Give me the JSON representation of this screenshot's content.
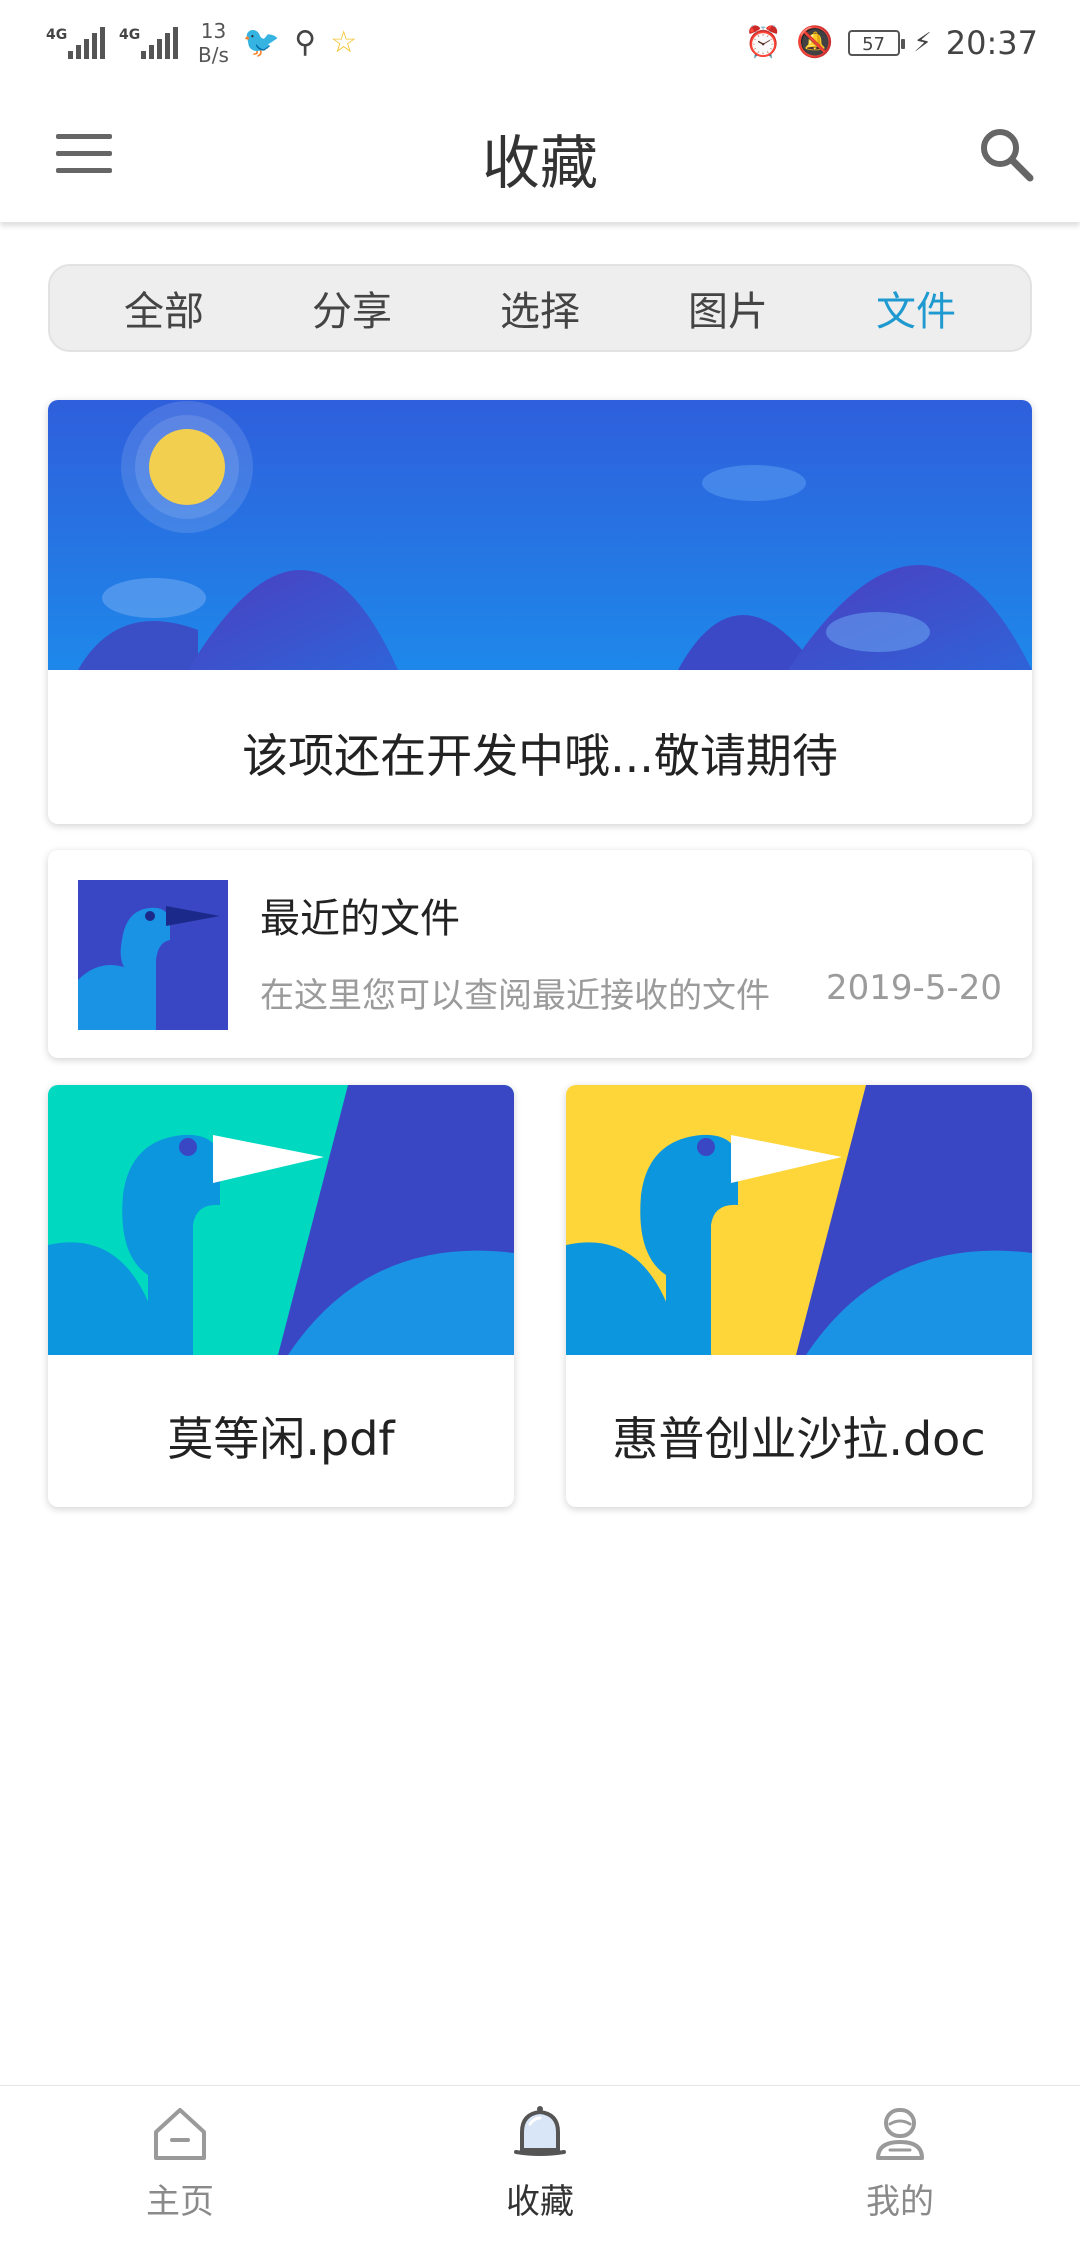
{
  "status_bar": {
    "signal1_tag": "4G",
    "signal2_tag": "4G",
    "net_speed_value": "13",
    "net_speed_unit": "B/s",
    "battery_level": "57",
    "time": "20:37",
    "icons": [
      "bird-icon",
      "usb-icon",
      "star-icon",
      "alarm-icon",
      "mute-icon",
      "battery-icon",
      "charging-icon"
    ]
  },
  "app_bar": {
    "title": "收藏",
    "menu_icon": "hamburger-menu-icon",
    "search_icon": "search-icon"
  },
  "tabs": [
    {
      "label": "全部",
      "active": false
    },
    {
      "label": "分享",
      "active": false
    },
    {
      "label": "选择",
      "active": false
    },
    {
      "label": "图片",
      "active": false
    },
    {
      "label": "文件",
      "active": true
    }
  ],
  "banner_card": {
    "message": "该项还在开发中哦...敬请期待"
  },
  "recent_files": {
    "title": "最近的文件",
    "description": "在这里您可以查阅最近接收的文件",
    "date": "2019-5-20"
  },
  "files": [
    {
      "name": "莫等闲.pdf",
      "accent": "#00d8bf"
    },
    {
      "name": "惠普创业沙拉.doc",
      "accent": "#ffd63a"
    }
  ],
  "bottom_nav": [
    {
      "label": "主页",
      "icon": "home-icon",
      "active": false
    },
    {
      "label": "收藏",
      "icon": "bell-icon",
      "active": true
    },
    {
      "label": "我的",
      "icon": "user-icon",
      "active": false
    }
  ],
  "colors": {
    "tab_active": "#1f9ad0",
    "banner_sky": "#2f67e0",
    "mountain": "#3b49c6",
    "bird": "#1a93e4",
    "dark_blue": "#3a47c4"
  }
}
